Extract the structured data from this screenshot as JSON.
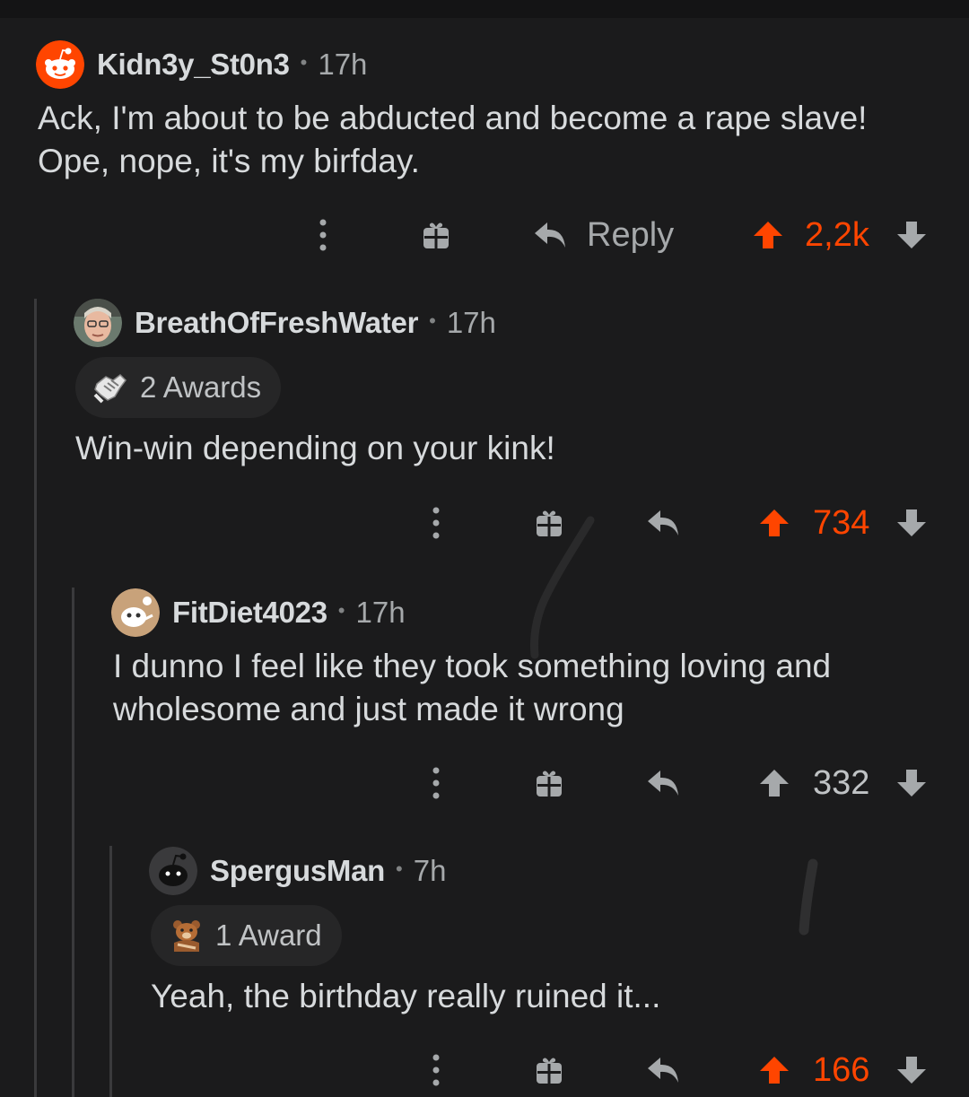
{
  "comments": [
    {
      "username": "Kidn3y_St0n3",
      "separator": "•",
      "time": "17h",
      "lines": [
        "Ack, I'm about to be abducted and become a rape slave!",
        "Ope, nope, it's my birfday."
      ],
      "actions": {
        "reply_label": "Reply",
        "score": "2,2k",
        "vote_state": "upvoted"
      }
    },
    {
      "username": "BreathOfFreshWater",
      "separator": "•",
      "time": "17h",
      "awards_label": "2 Awards",
      "lines": [
        "Win-win depending on your kink!"
      ],
      "actions": {
        "score": "734",
        "vote_state": "upvoted"
      }
    },
    {
      "username": "FitDiet4023",
      "separator": "•",
      "time": "17h",
      "lines": [
        "I dunno I feel like they took something loving and",
        "wholesome and just made it wrong"
      ],
      "actions": {
        "score": "332",
        "vote_state": "none"
      }
    },
    {
      "username": "SpergusMan",
      "separator": "•",
      "time": "7h",
      "awards_label": "1 Award",
      "lines": [
        "Yeah, the birthday really ruined it..."
      ],
      "actions": {
        "score": "166",
        "vote_state": "upvoted"
      }
    }
  ],
  "colors": {
    "upvote": "#ff4500",
    "background": "#1b1b1c",
    "text": "#d7dadc",
    "muted": "#a6a9ab"
  }
}
